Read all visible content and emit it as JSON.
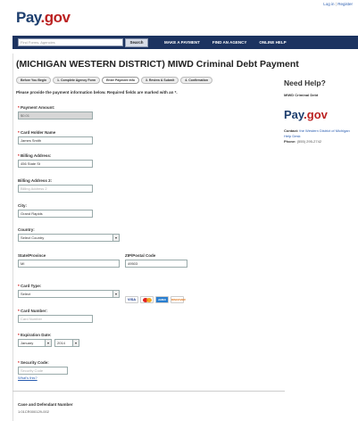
{
  "header": {
    "logo_text": "Pay",
    "logo_accent": ".gov",
    "login_link": "Log in",
    "separator": "|",
    "register_link": "Register"
  },
  "nav": {
    "search_placeholder": "Find Forms, Agencies",
    "search_button": "Search",
    "items": [
      "MAKE A PAYMENT",
      "FIND AN AGENCY",
      "ONLINE HELP"
    ]
  },
  "page": {
    "title": "(MICHIGAN WESTERN DISTRICT) MIWD Criminal Debt Payment",
    "steps": [
      "Before You Begin",
      "1. Complete Agency Form",
      "Enter Payment Info",
      "3. Review & Submit",
      "4. Confirmation"
    ],
    "instructions": "Please provide the payment information below. Required fields are marked with an *."
  },
  "form": {
    "payment_amount": {
      "label": "Payment Amount:",
      "value": "$0.01"
    },
    "card_holder": {
      "label": "Card Holder Name",
      "value": "James Smith"
    },
    "billing_address": {
      "label": "Billing Address:",
      "value": "456 State St"
    },
    "billing_address2": {
      "label": "Billing Address 2:",
      "placeholder": "Billing Address 2"
    },
    "city": {
      "label": "City:",
      "value": "Grand Rapids"
    },
    "country": {
      "label": "Country:",
      "value": "Select Country"
    },
    "state": {
      "label": "State/Province",
      "value": "MI"
    },
    "zip": {
      "label": "ZIP/Postal Code",
      "value": "49503"
    },
    "card_type": {
      "label": "Card Type:",
      "value": "Select"
    },
    "card_logos": [
      "VISA",
      "MC",
      "AMEX",
      "DISCOVER"
    ],
    "card_number": {
      "label": "Card Number:",
      "placeholder": "Card Number"
    },
    "expiration": {
      "label": "Expiration Date:",
      "month": "January",
      "year": "2014"
    },
    "security_code": {
      "label": "Security Code:",
      "placeholder": "Security Code",
      "help_link": "What's this?"
    },
    "case_number": {
      "label": "Case and Defendant Number",
      "value": "1:01CR000129-002"
    }
  },
  "sidebar": {
    "title": "Need Help?",
    "subtitle": "MIWD Criminal Debt",
    "logo_text": "Pay",
    "logo_accent": ".gov",
    "contact_label": "Contact:",
    "contact_text": "the Western District of Michigan Help Desk",
    "phone_label": "Phone:",
    "phone": "(555) 295-2742"
  },
  "colors": {
    "nav_bg": "#1c3360",
    "brand": "#1d3e6e",
    "accent": "#b22222"
  }
}
